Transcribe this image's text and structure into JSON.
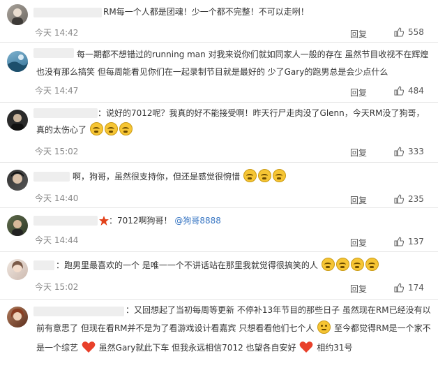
{
  "reply_label": "回复",
  "colors": {
    "link": "#3b78c4",
    "time": "#888888",
    "separator": "#e6e6e6"
  },
  "comments": [
    {
      "text": "RM每一个人都是团魂！少一个都不完整！不可以走咧！",
      "time": "今天 14:42",
      "likes": "558"
    },
    {
      "text_line1": "每一期都不想错过的running man 对我来说你们就如同家人一般的存在 虽然节目收视不在辉煌",
      "text_line2": "也没有那么搞笑 但每周能看见你们在一起录制节目就是最好的 少了Gary的跑男总是会少点什么",
      "time": "今天 14:47",
      "likes": "484"
    },
    {
      "text_line1": "：说好的7012呢？我真的好不能接受啊！昨天行尸走肉没了Glenn，今天RM没了狗哥，",
      "text_line2": "真的太伤心了",
      "time": "今天 15:02",
      "likes": "333"
    },
    {
      "text": "啊，狗哥，虽然很支持你，但还是感觉很惋惜",
      "time": "今天 14:40",
      "likes": "235"
    },
    {
      "text": "7012啊狗哥！",
      "mention": "@狗哥8888",
      "time": "今天 14:44",
      "likes": "137"
    },
    {
      "text": "：跑男里最喜欢的一个 是唯一一个不讲话站在那里我就觉得很搞笑的人",
      "time": "今天 15:02",
      "likes": "174"
    },
    {
      "text_line1": "：又回想起了当初每周等更新 不停补13年节目的那些日子 虽然现在RM已经没有以",
      "text_line2a": "前有意思了 但现在看RM并不是为了看游戏设计看嘉宾 只想看看他们七个人",
      "text_line2b": "至今都觉得RM是一个家不",
      "text_line3a": "是一个综艺",
      "text_line3b": "虽然Gary就此下车 但我永远相信7012 也望各自安好",
      "text_line3c": "相约31号"
    }
  ]
}
